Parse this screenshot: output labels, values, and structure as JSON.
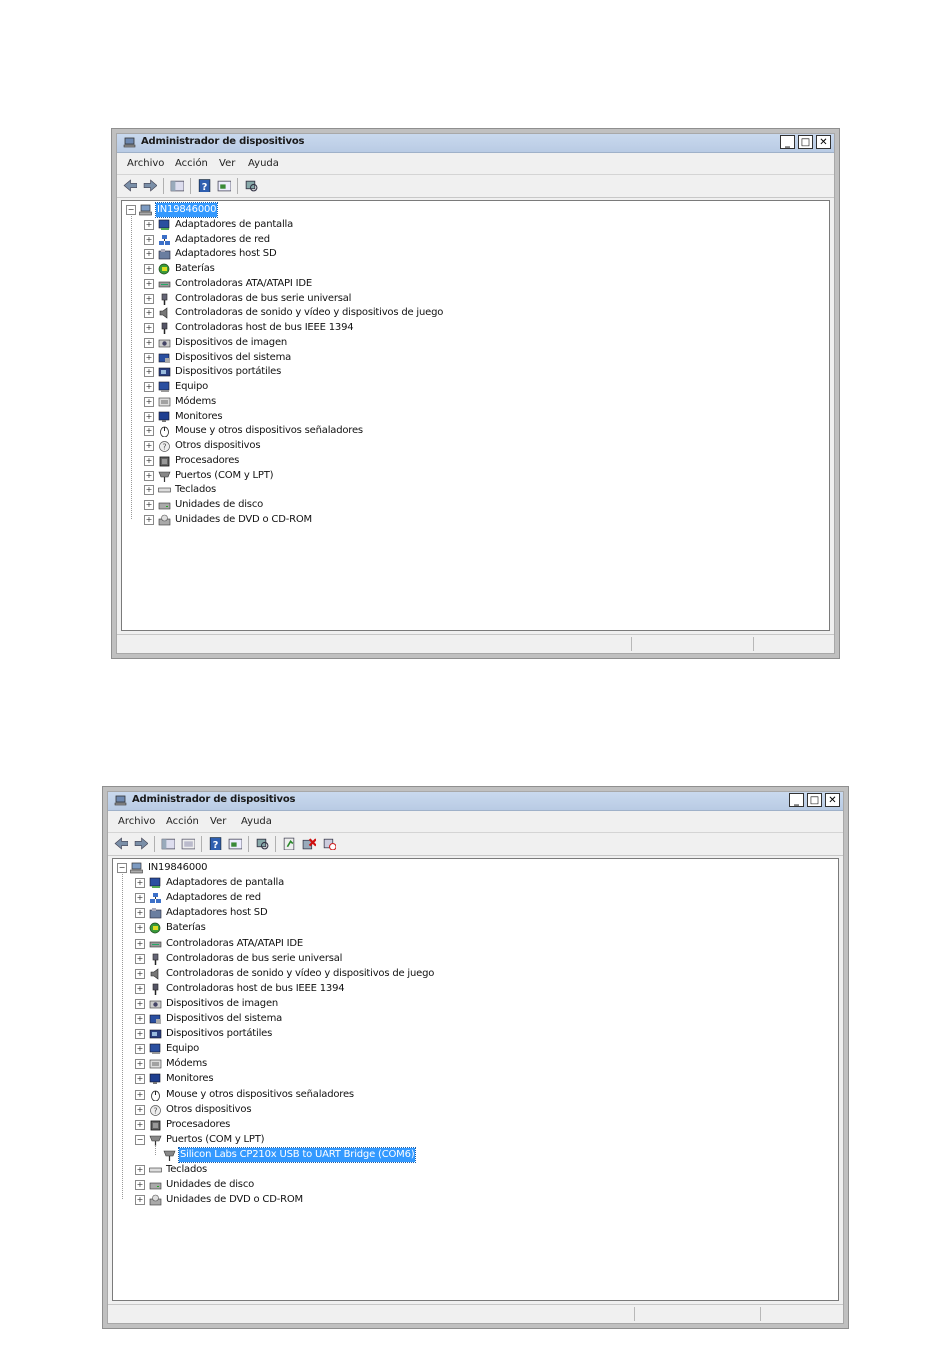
{
  "windows": [
    {
      "title": "Administrador de dispositivos",
      "menu": [
        "Archivo",
        "Acción",
        "Ver",
        "Ayuda"
      ],
      "controls": {
        "minimize": "_",
        "maximize": "□",
        "close": "✕"
      },
      "toolbar_icons": [
        "back-icon",
        "forward-icon",
        "console-tree-icon",
        "help-icon",
        "properties-icon",
        "scan-hardware-icon"
      ],
      "root": {
        "label": "IN19846000",
        "expanded": true,
        "selected": true
      },
      "items": [
        {
          "label": "Adaptadores de pantalla",
          "icon": "display-adapter-icon"
        },
        {
          "label": "Adaptadores de red",
          "icon": "network-adapter-icon"
        },
        {
          "label": "Adaptadores host SD",
          "icon": "sd-host-icon"
        },
        {
          "label": "Baterías",
          "icon": "battery-icon"
        },
        {
          "label": "Controladoras ATA/ATAPI IDE",
          "icon": "ide-controller-icon"
        },
        {
          "label": "Controladoras de bus serie universal",
          "icon": "usb-controller-icon"
        },
        {
          "label": "Controladoras de sonido y vídeo y dispositivos de juego",
          "icon": "sound-icon"
        },
        {
          "label": "Controladoras host de bus IEEE 1394",
          "icon": "ieee1394-icon"
        },
        {
          "label": "Dispositivos de imagen",
          "icon": "imaging-device-icon"
        },
        {
          "label": "Dispositivos del sistema",
          "icon": "system-device-icon"
        },
        {
          "label": "Dispositivos portátiles",
          "icon": "portable-device-icon"
        },
        {
          "label": "Equipo",
          "icon": "computer-icon"
        },
        {
          "label": "Módems",
          "icon": "modem-icon"
        },
        {
          "label": "Monitores",
          "icon": "monitor-icon"
        },
        {
          "label": "Mouse y otros dispositivos señaladores",
          "icon": "mouse-icon"
        },
        {
          "label": "Otros dispositivos",
          "icon": "other-device-icon"
        },
        {
          "label": "Procesadores",
          "icon": "processor-icon"
        },
        {
          "label": "Puertos (COM y LPT)",
          "icon": "port-icon"
        },
        {
          "label": "Teclados",
          "icon": "keyboard-icon"
        },
        {
          "label": "Unidades de disco",
          "icon": "disk-drive-icon"
        },
        {
          "label": "Unidades de DVD o CD-ROM",
          "icon": "dvd-drive-icon"
        }
      ]
    },
    {
      "title": "Administrador de dispositivos",
      "menu": [
        "Archivo",
        "Acción",
        "Ver",
        "Ayuda"
      ],
      "controls": {
        "minimize": "_",
        "maximize": "□",
        "close": "✕"
      },
      "toolbar_icons": [
        "back-icon",
        "forward-icon",
        "console-tree-icon",
        "show-hide-icon",
        "help-icon",
        "properties-icon",
        "scan-hardware-icon",
        "update-driver-icon",
        "uninstall-icon",
        "disable-icon"
      ],
      "root": {
        "label": "IN19846000",
        "expanded": true,
        "selected": false
      },
      "items": [
        {
          "label": "Adaptadores de pantalla",
          "icon": "display-adapter-icon"
        },
        {
          "label": "Adaptadores de red",
          "icon": "network-adapter-icon"
        },
        {
          "label": "Adaptadores host SD",
          "icon": "sd-host-icon"
        },
        {
          "label": "Baterías",
          "icon": "battery-icon"
        },
        {
          "label": "Controladoras ATA/ATAPI IDE",
          "icon": "ide-controller-icon"
        },
        {
          "label": "Controladoras de bus serie universal",
          "icon": "usb-controller-icon"
        },
        {
          "label": "Controladoras de sonido y vídeo y dispositivos de juego",
          "icon": "sound-icon"
        },
        {
          "label": "Controladoras host de bus IEEE 1394",
          "icon": "ieee1394-icon"
        },
        {
          "label": "Dispositivos de imagen",
          "icon": "imaging-device-icon"
        },
        {
          "label": "Dispositivos del sistema",
          "icon": "system-device-icon"
        },
        {
          "label": "Dispositivos portátiles",
          "icon": "portable-device-icon"
        },
        {
          "label": "Equipo",
          "icon": "computer-icon"
        },
        {
          "label": "Módems",
          "icon": "modem-icon"
        },
        {
          "label": "Monitores",
          "icon": "monitor-icon"
        },
        {
          "label": "Mouse y otros dispositivos señaladores",
          "icon": "mouse-icon"
        },
        {
          "label": "Otros dispositivos",
          "icon": "other-device-icon"
        },
        {
          "label": "Procesadores",
          "icon": "processor-icon"
        },
        {
          "label": "Puertos (COM y LPT)",
          "icon": "port-icon",
          "expanded": true,
          "children": [
            {
              "label": "Silicon Labs CP210x USB to UART Bridge (COM6)",
              "icon": "port-icon",
              "selected": true
            }
          ]
        },
        {
          "label": "Teclados",
          "icon": "keyboard-icon"
        },
        {
          "label": "Unidades de disco",
          "icon": "disk-drive-icon"
        },
        {
          "label": "Unidades de DVD o CD-ROM",
          "icon": "dvd-drive-icon"
        }
      ]
    }
  ]
}
